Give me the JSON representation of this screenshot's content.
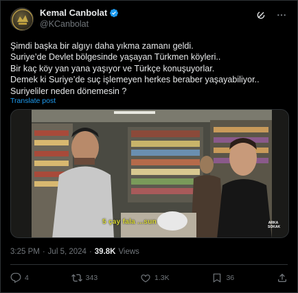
{
  "author": {
    "display_name": "Kemal Canbolat",
    "handle": "@KCanbolat",
    "verified": true
  },
  "top_icons": [
    "grok-icon",
    "more-icon"
  ],
  "tweet": {
    "lines": [
      "Şimdi başka bir algıyı daha yıkma zamanı geldi.",
      "Suriye’de Devlet bölgesinde yaşayan Türkmen köyleri..",
      "Bir kaç köy yan yana yaşıyor ve Türkçe konuşuyorlar.",
      "Demek ki Suriye’de suç işlemeyen herkes beraber yaşayabiliyor..",
      "Suriyeliler neden dönemesin ?"
    ],
    "translate_label": "Translate post"
  },
  "video": {
    "subtitle": "5 çay fala ...sun",
    "watermark": "ARKA SOKAK"
  },
  "meta": {
    "time": "3:25 PM",
    "separator": "·",
    "date": "Jul 5, 2024",
    "views_count": "39.8K",
    "views_label": "Views"
  },
  "engagement": {
    "replies": "4",
    "reposts": "343",
    "likes": "1.3K",
    "bookmarks": "36"
  },
  "colors": {
    "background": "#000000",
    "text": "#e7e9ea",
    "secondary": "#71767b",
    "accent": "#1d9bf0",
    "border": "#2f3336"
  }
}
